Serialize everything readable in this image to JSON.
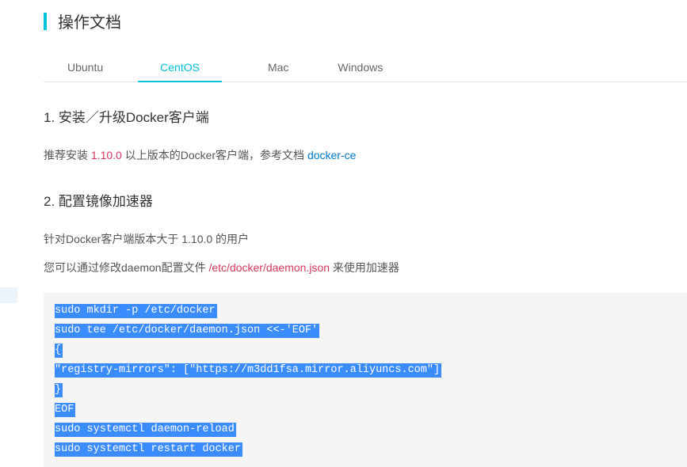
{
  "title": "操作文档",
  "tabs": {
    "ubuntu": "Ubuntu",
    "centos": "CentOS",
    "mac": "Mac",
    "windows": "Windows"
  },
  "section1": {
    "heading": "1. 安装／升级Docker客户端",
    "para_before_version": "推荐安装 ",
    "version": "1.10.0",
    "para_after_version": " 以上版本的Docker客户端，参考文档 ",
    "link": "docker-ce"
  },
  "section2": {
    "heading": "2. 配置镜像加速器",
    "para1": "针对Docker客户端版本大于 1.10.0 的用户",
    "para2_before": "您可以通过修改daemon配置文件 ",
    "para2_path": "/etc/docker/daemon.json",
    "para2_after": " 来使用加速器"
  },
  "code": {
    "line1": "sudo mkdir -p /etc/docker",
    "line2": "sudo tee /etc/docker/daemon.json <<-'EOF'",
    "line3": "{",
    "line4": "  \"registry-mirrors\": [\"https://m3dd1fsa.mirror.aliyuncs.com\"]",
    "line5": "}",
    "line6": "EOF",
    "line7": "sudo systemctl daemon-reload",
    "line8": "sudo systemctl restart docker"
  }
}
